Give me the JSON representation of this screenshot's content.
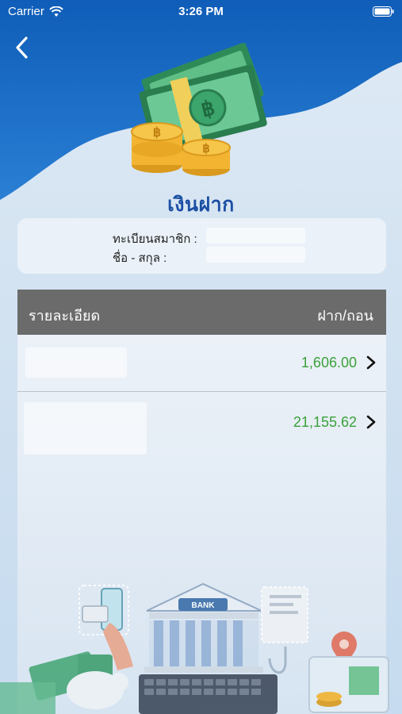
{
  "status_bar": {
    "carrier": "Carrier",
    "time": "3:26 PM"
  },
  "header": {
    "title": "เงินฝาก",
    "accent_color": "#1b4fa3",
    "bg_color": "#1565c0"
  },
  "member": {
    "id_label": "ทะเบียนสมาชิก :",
    "name_label": "ชื่อ - สกุล :"
  },
  "table": {
    "col_detail": "รายละเอียด",
    "col_deposit_withdraw": "ฝาก/ถอน",
    "rows": [
      {
        "amount": "1,606.00"
      },
      {
        "amount": "21,155.62"
      }
    ],
    "amount_color": "#3aa13a"
  },
  "illustration": {
    "bank_sign": "BANK"
  },
  "icons": [
    "wifi-icon",
    "battery-icon",
    "back-icon",
    "chevron-right-icon",
    "money-coins-icon",
    "bank-illustration"
  ]
}
